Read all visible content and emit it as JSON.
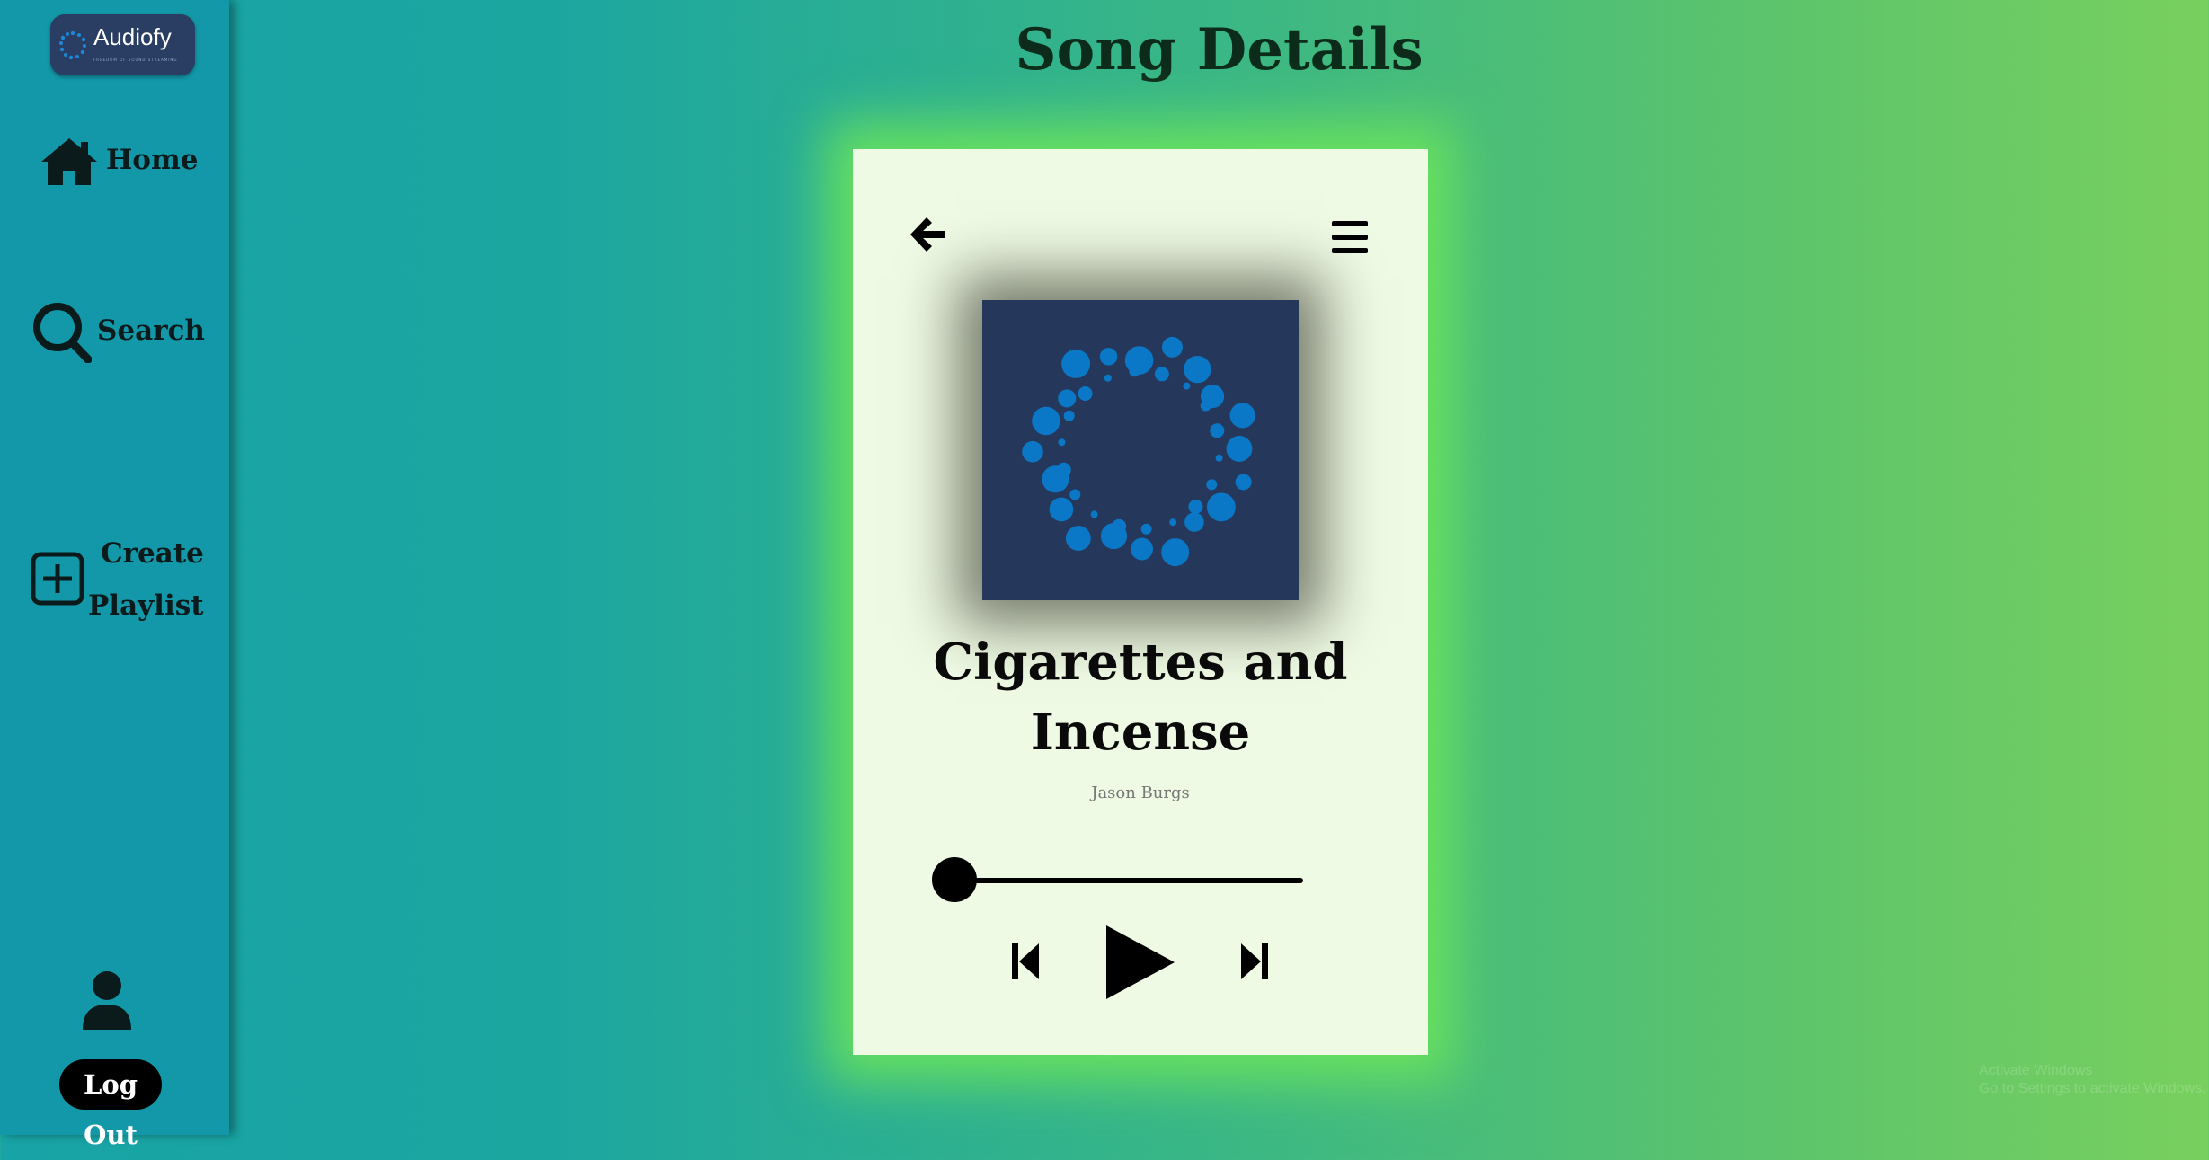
{
  "app": {
    "name": "Audiofy",
    "tagline": "FREEDOM OF SOUND STREAMING"
  },
  "sidebar": {
    "items": [
      {
        "label": "Home",
        "icon": "home-icon"
      },
      {
        "label": "Search",
        "icon": "search-icon"
      },
      {
        "label_line1": "Create",
        "label_line2": "Playlist",
        "icon": "plus-square-icon"
      }
    ],
    "user_icon": "user-icon",
    "logout_label": "Log Out"
  },
  "page": {
    "title": "Song Details"
  },
  "song": {
    "title": "Cigarettes and Incense",
    "artist": "Jason Burgs"
  },
  "player": {
    "progress_fraction": 0.0,
    "controls": [
      "previous-icon",
      "play-icon",
      "next-icon"
    ]
  },
  "watermark": {
    "line1": "Activate Windows",
    "line2": "Go to Settings to activate Windows."
  },
  "colors": {
    "sidebar": "#1398a9",
    "card": "#eefae3",
    "cover": "#25385b",
    "dots": "#0a78c6",
    "glow": "#6ee65a"
  }
}
